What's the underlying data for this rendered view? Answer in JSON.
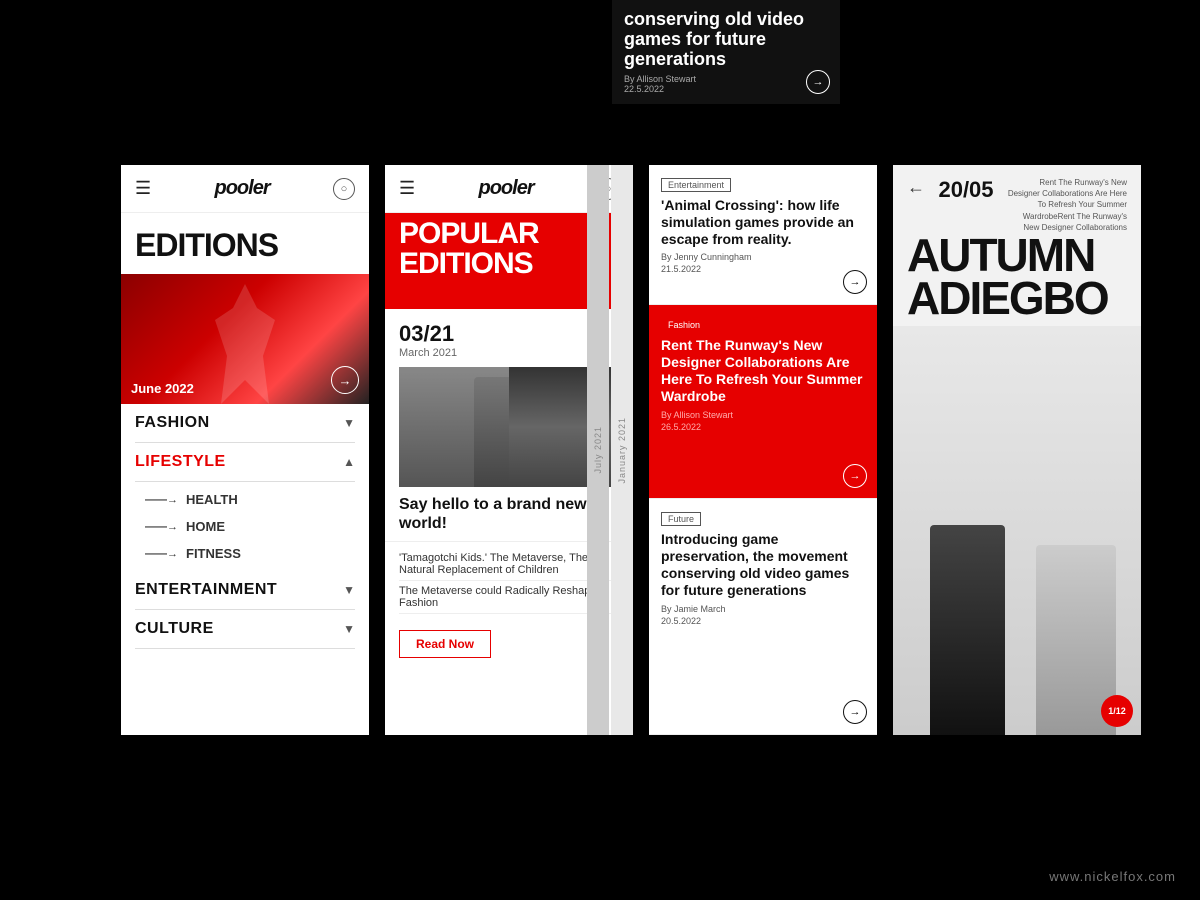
{
  "background": "#000000",
  "website": "www.nickelfox.com",
  "panel1": {
    "logo": "pooler",
    "nav_title": "EDITIONS",
    "hero_label": "June 2022",
    "nav_items": [
      {
        "label": "FASHION",
        "type": "dropdown",
        "expanded": false
      },
      {
        "label": "LIFESTYLE",
        "type": "dropdown",
        "expanded": true,
        "color": "red",
        "sub_items": [
          "HEALTH",
          "HOME",
          "FITNESS"
        ]
      },
      {
        "label": "ENTERTAINMENT",
        "type": "dropdown",
        "expanded": false
      },
      {
        "label": "CULTURE",
        "type": "dropdown",
        "expanded": false
      }
    ]
  },
  "panel2": {
    "logo": "pooler",
    "title_line1": "POPULAR",
    "title_line2": "EDITIONS",
    "edition": {
      "code": "03/21",
      "month": "March 2021",
      "description": "Say hello to a brand new world!",
      "read_btn": "Read Now"
    },
    "mini_links": [
      "'Tamagotchi Kids.' The Metaverse, The Natural Replacement of Children",
      "The Metaverse could Radically Reshape Fashion"
    ],
    "timelines": [
      "July 2021",
      "January 2021"
    ]
  },
  "panel3": {
    "articles": [
      {
        "tag": "Entertainment",
        "tag_red": false,
        "headline": "'Animal Crossing': how life simulation games provide an escape from reality.",
        "byline": "By Jenny Cunningham",
        "date": "21.5.2022",
        "bg": "white"
      },
      {
        "tag": "Fashion",
        "tag_red": true,
        "headline": "Rent The Runway's New Designer Collaborations Are Here To Refresh Your Summer Wardrobe",
        "byline": "By Allison Stewart",
        "date": "26.5.2022",
        "bg": "red"
      },
      {
        "tag": "Future",
        "tag_red": false,
        "headline": "Introducing game preservation, the movement conserving old video games for future generations",
        "byline": "By Jamie March",
        "date": "20.5.2022",
        "bg": "white"
      }
    ]
  },
  "panel4": {
    "back_icon": "←",
    "date": "20/05",
    "meta": "Rent The Runway's New Designer Collaborations Are Here To Refresh Your Summer WardrobeRent The Runway's New Designer Collaborations",
    "title_line1": "AUTUMN",
    "title_line2": "ADIEGBO",
    "counter": "1/12"
  },
  "top_partial": {
    "headline": "conserving old video games for future generations",
    "byline": "By Allison Stewart",
    "date": "22.5.2022"
  }
}
